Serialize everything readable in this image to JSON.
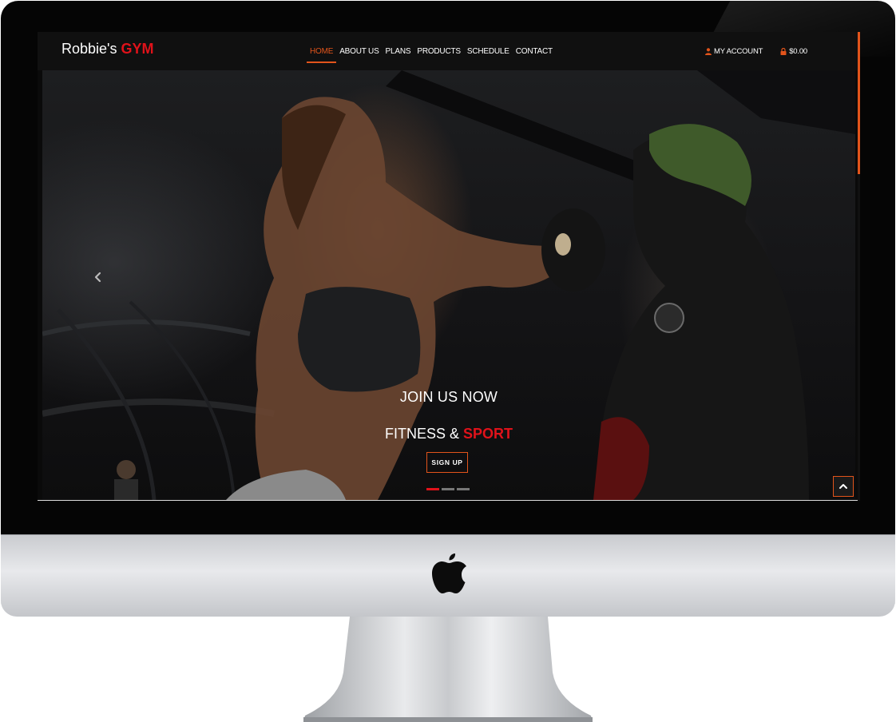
{
  "site": {
    "logo_main": "Robbie's ",
    "logo_accent": "GYM"
  },
  "nav": {
    "items": [
      {
        "label": "HOME",
        "active": true
      },
      {
        "label": "ABOUT US",
        "active": false
      },
      {
        "label": "PLANS",
        "active": false
      },
      {
        "label": "PRODUCTS",
        "active": false
      },
      {
        "label": "SCHEDULE",
        "active": false
      },
      {
        "label": "CONTACT",
        "active": false
      }
    ],
    "account_label": "MY ACCOUNT",
    "account_icon": "user-icon",
    "cart_label": "$0.00",
    "cart_icon": "lock-bag-icon"
  },
  "hero": {
    "title": "JOIN US NOW",
    "subtitle_main": "FITNESS & ",
    "subtitle_accent": "SPORT",
    "cta_label": "SIGN UP",
    "prev_icon": "chevron-left-icon",
    "slide_count": 3,
    "active_slide": 1
  },
  "back_to_top_icon": "chevron-up-icon",
  "colors": {
    "brand_red": "#e0121a",
    "accent_orange": "#e2541b",
    "nav_background": "#101010"
  }
}
